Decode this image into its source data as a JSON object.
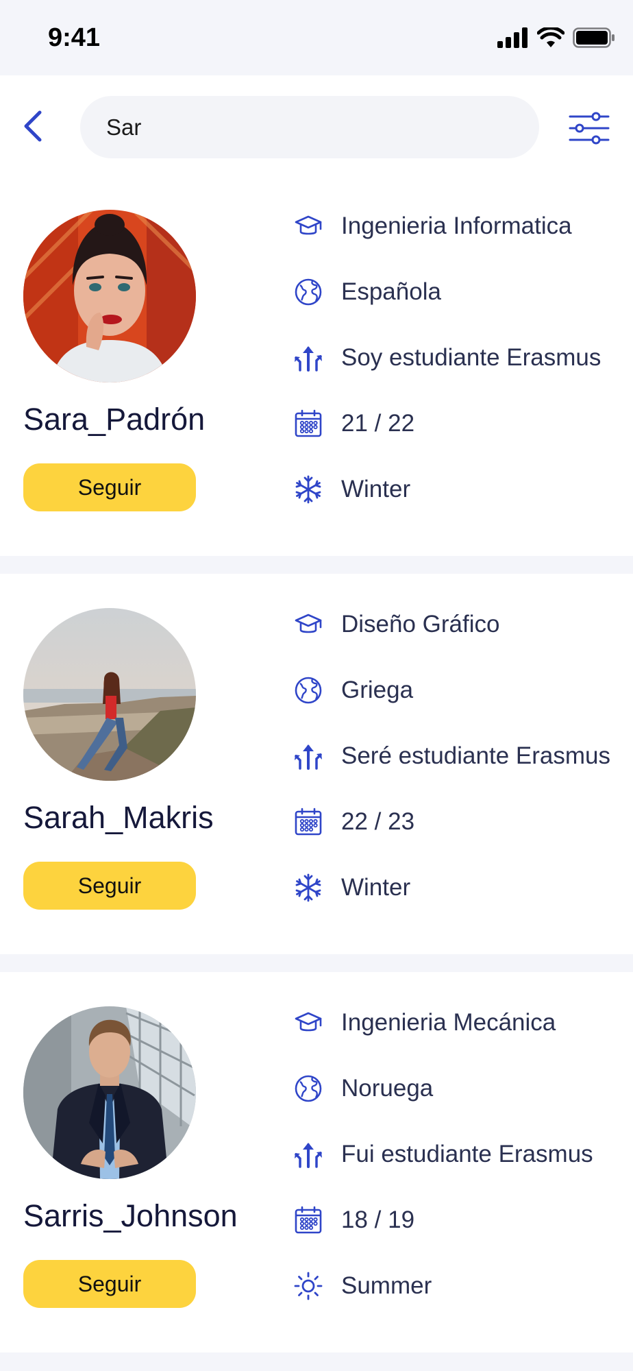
{
  "status": {
    "time": "9:41"
  },
  "search": {
    "value": "Sar"
  },
  "icons": {
    "back": "chevron-left-icon",
    "filter": "sliders-icon",
    "career": "graduation-cap-icon",
    "nationality": "globe-icon",
    "erasmus": "split-arrows-icon",
    "year": "calendar-icon",
    "season_winter": "snowflake-icon",
    "season_summer": "sun-icon"
  },
  "colors": {
    "accent": "#2f45c8",
    "follow_button": "#fdd33e",
    "background": "#f4f5fa"
  },
  "users": [
    {
      "username": "Sara_Padrón",
      "follow_label": "Seguir",
      "career": "Ingenieria Informatica",
      "nationality": "Española",
      "erasmus_status": "Soy estudiante Erasmus",
      "academic_year": "21 / 22",
      "season": "Winter"
    },
    {
      "username": "Sarah_Makris",
      "follow_label": "Seguir",
      "career": "Diseño Gráfico",
      "nationality": "Griega",
      "erasmus_status": "Seré estudiante Erasmus",
      "academic_year": "22 / 23",
      "season": "Winter"
    },
    {
      "username": "Sarris_Johnson",
      "follow_label": "Seguir",
      "career": "Ingenieria Mecánica",
      "nationality": "Noruega",
      "erasmus_status": "Fui estudiante Erasmus",
      "academic_year": "18 / 19",
      "season": "Summer"
    }
  ]
}
